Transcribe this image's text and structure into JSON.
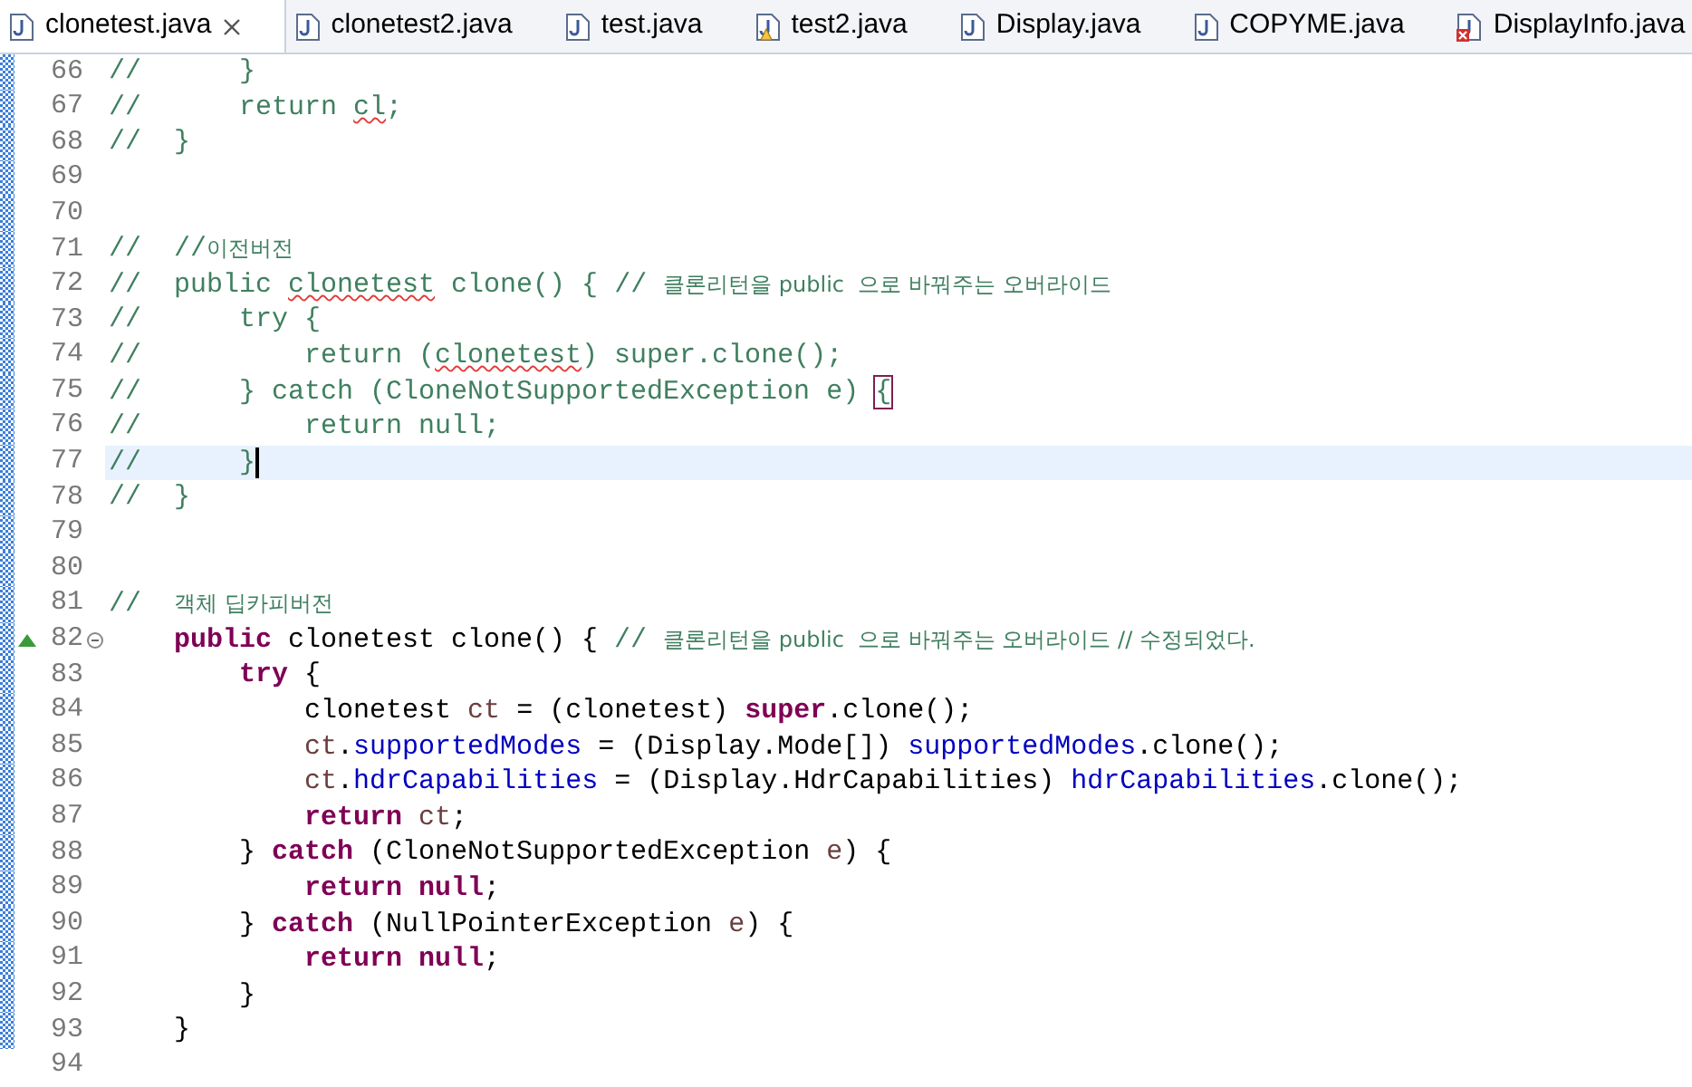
{
  "tabs": [
    {
      "label": "clonetest.java",
      "selected": true,
      "warning": false,
      "error": false
    },
    {
      "label": "clonetest2.java",
      "selected": false,
      "warning": false,
      "error": false
    },
    {
      "label": "test.java",
      "selected": false,
      "warning": false,
      "error": false
    },
    {
      "label": "test2.java",
      "selected": false,
      "warning": true,
      "error": false
    },
    {
      "label": "Display.java",
      "selected": false,
      "warning": false,
      "error": false
    },
    {
      "label": "COPYME.java",
      "selected": false,
      "warning": false,
      "error": false
    },
    {
      "label": "DisplayInfo.java",
      "selected": false,
      "warning": false,
      "error": true
    }
  ],
  "lines": [
    {
      "number": "66",
      "in_range": true,
      "current": false,
      "segments": [
        {
          "kind": "comment",
          "text": "//      }"
        }
      ]
    },
    {
      "number": "67",
      "in_range": true,
      "current": false,
      "segments": [
        {
          "kind": "comment",
          "text": "//      return "
        },
        {
          "kind": "comment",
          "text": "cl",
          "squiggle": true
        },
        {
          "kind": "comment",
          "text": ";"
        }
      ]
    },
    {
      "number": "68",
      "in_range": true,
      "current": false,
      "segments": [
        {
          "kind": "comment",
          "text": "//  }"
        }
      ]
    },
    {
      "number": "69",
      "in_range": true,
      "current": false
    },
    {
      "number": "70",
      "in_range": true,
      "current": false
    },
    {
      "number": "71",
      "in_range": true,
      "current": false,
      "segments": [
        {
          "kind": "comment",
          "text": "//  //"
        },
        {
          "kind": "note",
          "text": "이전버전"
        }
      ]
    },
    {
      "number": "72",
      "in_range": true,
      "current": false,
      "segments": [
        {
          "kind": "comment",
          "text": "//  public "
        },
        {
          "kind": "comment",
          "text": "clonetest",
          "squiggle": true
        },
        {
          "kind": "comment",
          "text": " clone() { // "
        },
        {
          "kind": "note",
          "text": "클론리턴을 public  으로 바꿔주는 오버라이드"
        }
      ]
    },
    {
      "number": "73",
      "in_range": true,
      "current": false,
      "segments": [
        {
          "kind": "comment",
          "text": "//      try {"
        }
      ]
    },
    {
      "number": "74",
      "in_range": true,
      "current": false,
      "segments": [
        {
          "kind": "comment",
          "text": "//          return ("
        },
        {
          "kind": "comment",
          "text": "clonetest",
          "squiggle": true
        },
        {
          "kind": "comment",
          "text": ") super.clone();"
        }
      ]
    },
    {
      "number": "75",
      "in_range": true,
      "current": false,
      "segments": [
        {
          "kind": "comment",
          "text": "//      } catch (CloneNotSupportedException e) "
        },
        {
          "kind": "comment",
          "text": "{",
          "bracket_match": true
        }
      ]
    },
    {
      "number": "76",
      "in_range": true,
      "current": false,
      "segments": [
        {
          "kind": "comment",
          "text": "//          return null;"
        }
      ]
    },
    {
      "number": "77",
      "in_range": true,
      "current": true,
      "segments": [
        {
          "kind": "comment",
          "text": "//      }"
        }
      ]
    },
    {
      "number": "78",
      "in_range": true,
      "current": false,
      "segments": [
        {
          "kind": "comment",
          "text": "//  }"
        }
      ]
    },
    {
      "number": "79",
      "in_range": true,
      "current": false
    },
    {
      "number": "80",
      "in_range": true,
      "current": false
    },
    {
      "number": "81",
      "in_range": true,
      "current": false,
      "segments": [
        {
          "kind": "comment",
          "text": "//  "
        },
        {
          "kind": "note",
          "text": "객체 딥카피버전"
        }
      ]
    },
    {
      "number": "82",
      "in_range": true,
      "current": false,
      "override": true,
      "folded": false,
      "segments": [
        {
          "kind": "keyword",
          "text": "    public"
        },
        {
          "kind": "plain",
          "text": " clonetest clone() { "
        },
        {
          "kind": "comment",
          "text": "// "
        },
        {
          "kind": "note",
          "text": "클론리턴을 public  으로 바꿔주는 오버라이드 // 수정되었다."
        }
      ]
    },
    {
      "number": "83",
      "in_range": true,
      "current": false,
      "segments": [
        {
          "kind": "keyword",
          "text": "        try"
        },
        {
          "kind": "plain",
          "text": " {"
        }
      ]
    },
    {
      "number": "84",
      "in_range": true,
      "current": false,
      "segments": [
        {
          "kind": "plain",
          "text": "            clonetest "
        },
        {
          "kind": "local",
          "text": "ct"
        },
        {
          "kind": "plain",
          "text": " = (clonetest) "
        },
        {
          "kind": "keyword",
          "text": "super"
        },
        {
          "kind": "plain",
          "text": ".clone();"
        }
      ]
    },
    {
      "number": "85",
      "in_range": true,
      "current": false,
      "segments": [
        {
          "kind": "local",
          "text": "            ct"
        },
        {
          "kind": "plain",
          "text": "."
        },
        {
          "kind": "field",
          "text": "supportedModes"
        },
        {
          "kind": "plain",
          "text": " = (Display.Mode[]) "
        },
        {
          "kind": "field",
          "text": "supportedModes"
        },
        {
          "kind": "plain",
          "text": ".clone();"
        }
      ]
    },
    {
      "number": "86",
      "in_range": true,
      "current": false,
      "segments": [
        {
          "kind": "local",
          "text": "            ct"
        },
        {
          "kind": "plain",
          "text": "."
        },
        {
          "kind": "field",
          "text": "hdrCapabilities"
        },
        {
          "kind": "plain",
          "text": " = (Display.HdrCapabilities) "
        },
        {
          "kind": "field",
          "text": "hdrCapabilities"
        },
        {
          "kind": "plain",
          "text": ".clone();"
        }
      ]
    },
    {
      "number": "87",
      "in_range": true,
      "current": false,
      "segments": [
        {
          "kind": "keyword",
          "text": "            return"
        },
        {
          "kind": "local",
          "text": " ct"
        },
        {
          "kind": "plain",
          "text": ";"
        }
      ]
    },
    {
      "number": "88",
      "in_range": true,
      "current": false,
      "segments": [
        {
          "kind": "plain",
          "text": "        } "
        },
        {
          "kind": "keyword",
          "text": "catch"
        },
        {
          "kind": "plain",
          "text": " (CloneNotSupportedException "
        },
        {
          "kind": "local",
          "text": "e"
        },
        {
          "kind": "plain",
          "text": ") {"
        }
      ]
    },
    {
      "number": "89",
      "in_range": true,
      "current": false,
      "segments": [
        {
          "kind": "keyword",
          "text": "            return null"
        },
        {
          "kind": "plain",
          "text": ";"
        }
      ]
    },
    {
      "number": "90",
      "in_range": true,
      "current": false,
      "segments": [
        {
          "kind": "plain",
          "text": "        } "
        },
        {
          "kind": "keyword",
          "text": "catch"
        },
        {
          "kind": "plain",
          "text": " (NullPointerException "
        },
        {
          "kind": "local",
          "text": "e"
        },
        {
          "kind": "plain",
          "text": ") {"
        }
      ]
    },
    {
      "number": "91",
      "in_range": true,
      "current": false,
      "segments": [
        {
          "kind": "keyword",
          "text": "            return null"
        },
        {
          "kind": "plain",
          "text": ";"
        }
      ]
    },
    {
      "number": "92",
      "in_range": true,
      "current": false,
      "segments": [
        {
          "kind": "plain",
          "text": "        }"
        }
      ]
    },
    {
      "number": "93",
      "in_range": true,
      "current": false,
      "segments": [
        {
          "kind": "plain",
          "text": "    }"
        }
      ]
    },
    {
      "number": "94",
      "in_range": false,
      "current": false
    }
  ]
}
